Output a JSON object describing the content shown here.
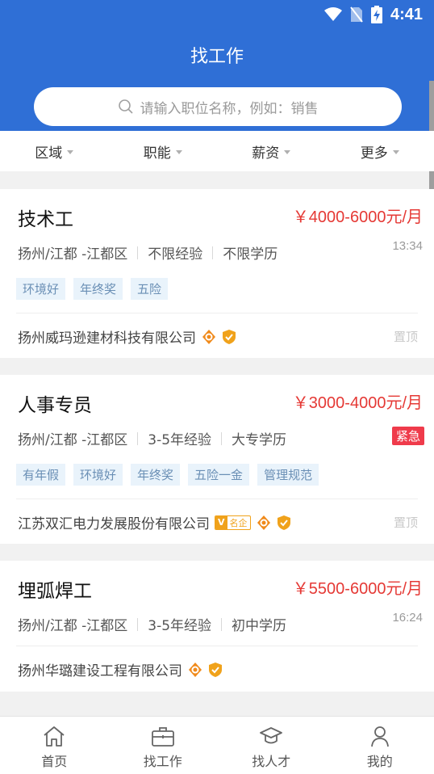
{
  "status_bar": {
    "time": "4:41",
    "icons": [
      "wifi-icon",
      "no-sim-icon",
      "battery-charging-icon"
    ]
  },
  "header": {
    "title": "找工作"
  },
  "search": {
    "placeholder": "请输入职位名称，例如：销售"
  },
  "filters": [
    {
      "label": "区域"
    },
    {
      "label": "职能"
    },
    {
      "label": "薪资"
    },
    {
      "label": "更多"
    }
  ],
  "jobs": [
    {
      "title": "技术工",
      "salary": "￥4000-6000元/月",
      "location": "扬州/江都 -江都区",
      "experience": "不限经验",
      "education": "不限学历",
      "time": "13:34",
      "tags": [
        "环境好",
        "年终奖",
        "五险"
      ],
      "company": "扬州威玛逊建材科技有限公司",
      "pin": "置顶"
    },
    {
      "title": "人事专员",
      "salary": "￥3000-4000元/月",
      "location": "扬州/江都 -江都区",
      "experience": "3-5年经验",
      "education": "大专学历",
      "urgent": "紧急",
      "tags": [
        "有年假",
        "环境好",
        "年终奖",
        "五险一金",
        "管理规范"
      ],
      "company": "江苏双汇电力发展股份有限公司",
      "famous_badge": {
        "v": "V",
        "text": "名企"
      },
      "pin": "置顶"
    },
    {
      "title": "埋弧焊工",
      "salary": "￥5500-6000元/月",
      "location": "扬州/江都 -江都区",
      "experience": "3-5年经验",
      "education": "初中学历",
      "time": "16:24",
      "company": "扬州华璐建设工程有限公司"
    }
  ],
  "tabs": [
    {
      "label": "首页",
      "icon": "home-icon"
    },
    {
      "label": "找工作",
      "icon": "briefcase-icon"
    },
    {
      "label": "找人才",
      "icon": "graduation-cap-icon"
    },
    {
      "label": "我的",
      "icon": "user-icon"
    }
  ],
  "colors": {
    "primary": "#2f6fd6",
    "salary": "#e53935",
    "urgent": "#ef3b4b",
    "tag_bg": "#e9f3fb",
    "tag_text": "#6a8fb5",
    "badge_orange": "#f0a21b"
  }
}
